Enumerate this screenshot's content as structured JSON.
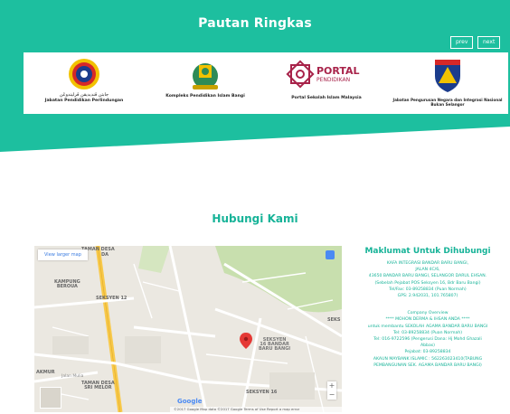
{
  "colors": {
    "teal": "#1dbf9f",
    "teal_text": "#17b398",
    "white": "#ffffff"
  },
  "pautan": {
    "title": "Pautan Ringkas",
    "prev_label": "prev",
    "next_label": "next",
    "cards": [
      {
        "caption": "Jabatan Pendidikan Perlindungan",
        "caption_ar": "جابتن ڤنديديقن ڤرليندوڠن",
        "icon": "jabatan-emblem-icon"
      },
      {
        "caption": "Kompleks Pendidikan Islam Bangi",
        "icon": "kompleks-crest-icon"
      },
      {
        "caption": "Portal Sekolah Islam Malaysia",
        "icon": "portal-pendidikan-logo-icon",
        "logo_text": "PORTAL",
        "logo_sub": "PENDIDIKAN"
      },
      {
        "caption": "Jabatan Pengurusan Negara dan Integrasi Nasional Bukan Selangor",
        "icon": "shield-emblem-icon"
      }
    ]
  },
  "hubungi": {
    "title": "Hubungi Kami"
  },
  "map": {
    "view_larger": "View larger map",
    "labels": {
      "taman_desa_top": "TAMAN DESA",
      "da": "DA",
      "kampung_beroua": "KAMPUNG\nBEROUA",
      "seksyen12": "SEKSYEN 12",
      "akmur": "AKMUR",
      "taman_desa_sri": "TAMAN DESA\nSRI MELOR",
      "jalan_mulia": "Jalan Mulia",
      "seksyen16_bangi": "SEKSYEN\n16 BANDAR\nBARU BANGI",
      "seksyen16": "SEKSYEN 16",
      "seks": "SEKS"
    },
    "footer": "©2017 Google  Map data ©2017 Google  Terms of Use  Report a map error",
    "google": "Google",
    "zoom_in": "+",
    "zoom_out": "−"
  },
  "info": {
    "title": "Maklumat Untuk Dihubungi",
    "lines_a": [
      "KAFA INTEGRASI BANDAR BARU BANGI,",
      "JALAN 4C/6,",
      "43650 BANDAR BARU BANGI, SELANGOR DARUL EHSAN.",
      "(Sebelah Pejabat POS Seksyen 16, Bdr Baru Bangi)",
      "Tel/Fax: 03-89258834 (Puan Normah)",
      "GPS: 2.942031, 101.765807)"
    ],
    "lines_b": [
      "Company Overview",
      "**** MOHON DERMA & IHSAN ANDA ****",
      "untuk membantu SEKOLAH AGAMA BANDAR BARU BANGI",
      "Tel: 03-89258834 (Puan Normah)",
      "Tel: 016-9722596 (Pengerusi Dana: Hj Mohd Ghazali",
      "Abbas)",
      "Pejabat: 03-89258834",
      "AKAUN MAYBANK ISLAMIC : 562263023410(TABUNG",
      "PEMBANGUNAN SEK. AGAMA BANDAR BARU BANGI)"
    ]
  }
}
